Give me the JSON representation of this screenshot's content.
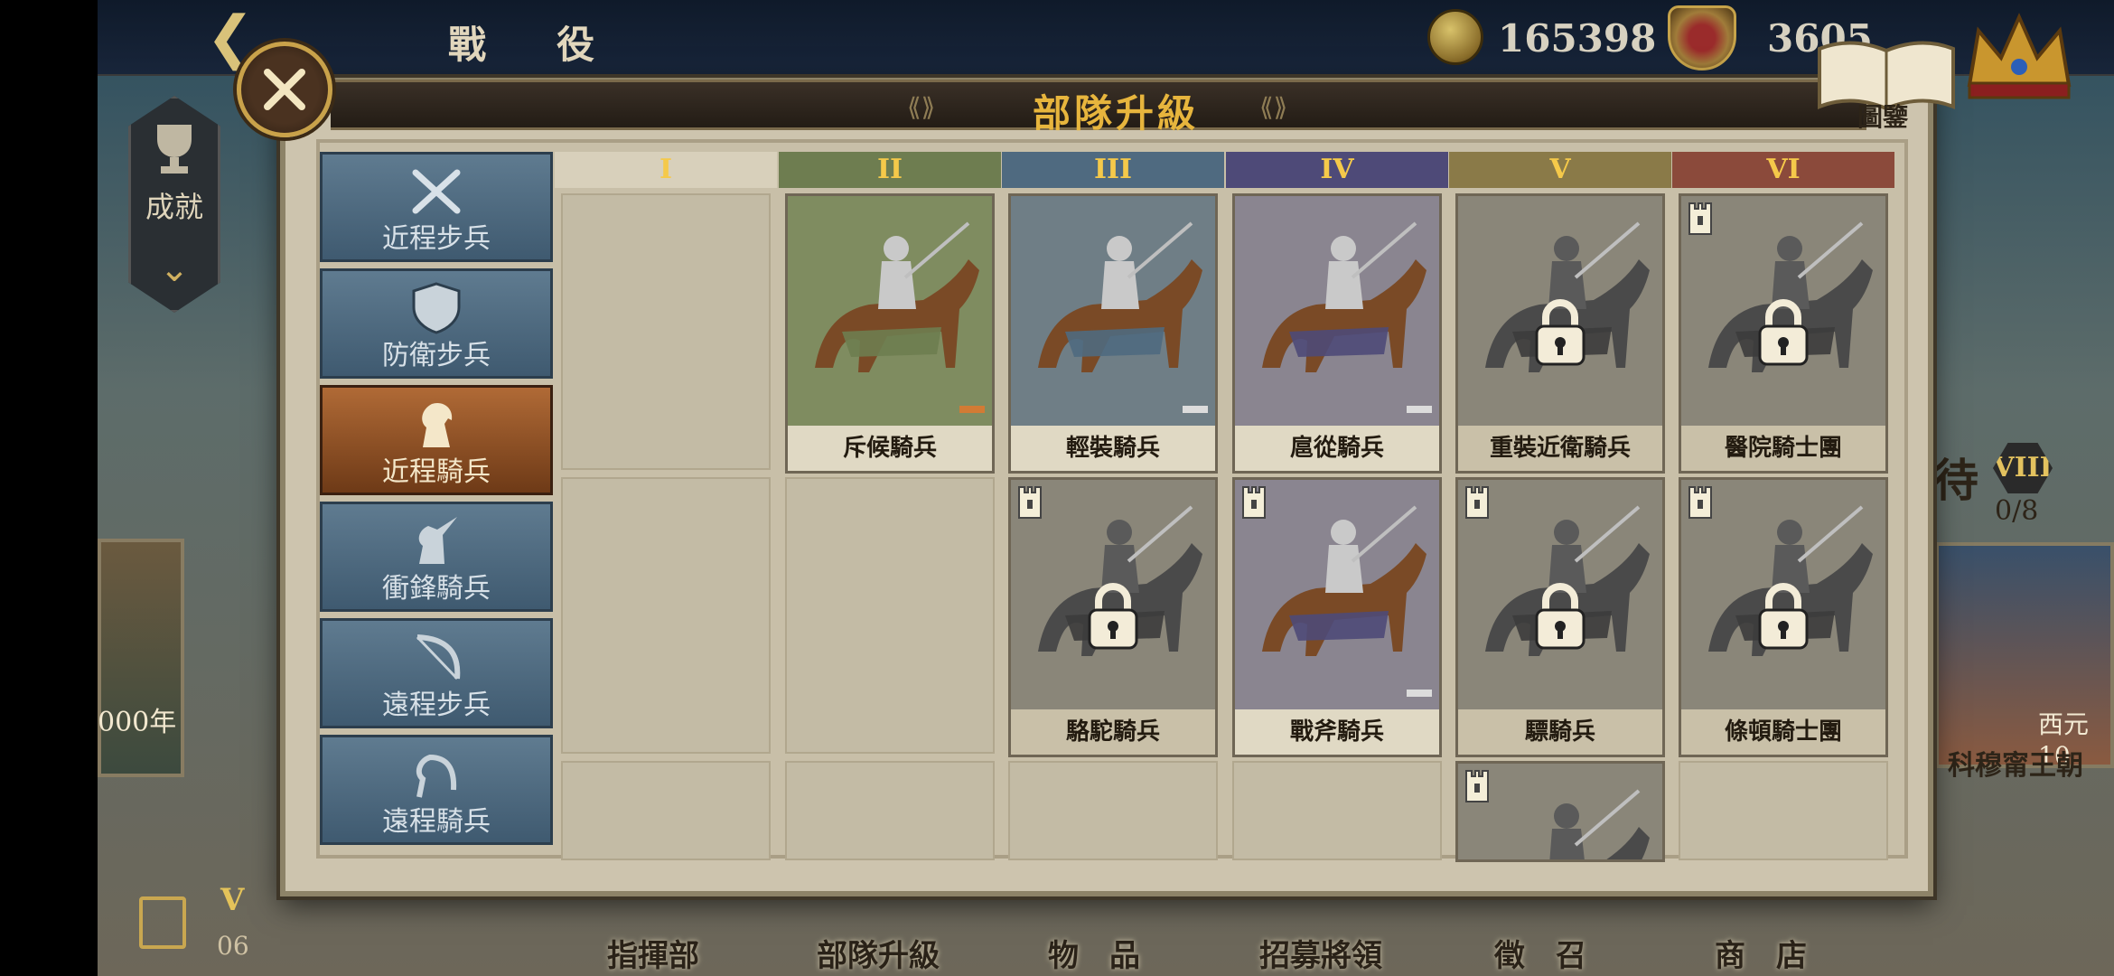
{
  "header": {
    "title": "戰　役",
    "gold": "165398",
    "prestige": "3605"
  },
  "left_panel": {
    "achievement_label": "成就",
    "card_year": "000年",
    "chapter_numeral": "V",
    "chapter_sub": "06"
  },
  "bottom_nav": [
    "指揮部",
    "部隊升級",
    "物　品",
    "招募將領",
    "徵　召",
    "商　店"
  ],
  "right_panel": {
    "banner_text": "待",
    "badge": "VIII",
    "count": "0/8",
    "year": "西元10",
    "dynasty": "科穆甯王朝"
  },
  "dialog": {
    "title": "部隊升級",
    "codex_label": "圖鑒"
  },
  "sidebar": [
    {
      "label": "近程步兵",
      "icon": "crossed-swords-icon"
    },
    {
      "label": "防衛步兵",
      "icon": "shield-icon"
    },
    {
      "label": "近程騎兵",
      "icon": "knight-horse-icon",
      "active": true
    },
    {
      "label": "衝鋒騎兵",
      "icon": "horse-lance-icon"
    },
    {
      "label": "遠程步兵",
      "icon": "bow-icon"
    },
    {
      "label": "遠程騎兵",
      "icon": "horse-bow-icon"
    }
  ],
  "tiers": [
    {
      "label": "I",
      "color": "#d8d0bb"
    },
    {
      "label": "II",
      "color": "#6e7d50"
    },
    {
      "label": "III",
      "color": "#4f6a80"
    },
    {
      "label": "IV",
      "color": "#4e4a78"
    },
    {
      "label": "V",
      "color": "#8a7a48"
    },
    {
      "label": "VI",
      "color": "#8b4a3b"
    }
  ],
  "units": [
    {
      "name": "斥候騎兵",
      "tier": 2,
      "row": 1,
      "locked": false,
      "rank_color": "#d27b34"
    },
    {
      "name": "輕裝騎兵",
      "tier": 3,
      "row": 1,
      "locked": false,
      "rank_color": "#dcdcdc"
    },
    {
      "name": "扈從騎兵",
      "tier": 4,
      "row": 1,
      "locked": false,
      "rank_color": "#dcdcdc"
    },
    {
      "name": "重裝近衛騎兵",
      "tier": 5,
      "row": 1,
      "locked": true,
      "tower": false
    },
    {
      "name": "醫院騎士團",
      "tier": 6,
      "row": 1,
      "locked": true,
      "tower": true
    },
    {
      "name": "駱駝騎兵",
      "tier": 3,
      "row": 2,
      "locked": true,
      "tower": true
    },
    {
      "name": "戰斧騎兵",
      "tier": 4,
      "row": 2,
      "locked": false,
      "tower": true,
      "rank_color": "#dcdcdc"
    },
    {
      "name": "驃騎兵",
      "tier": 5,
      "row": 2,
      "locked": true,
      "tower": true
    },
    {
      "name": "條頓騎士團",
      "tier": 6,
      "row": 2,
      "locked": true,
      "tower": true
    },
    {
      "name": "",
      "tier": 5,
      "row": 3,
      "locked": true,
      "tower": true
    }
  ]
}
